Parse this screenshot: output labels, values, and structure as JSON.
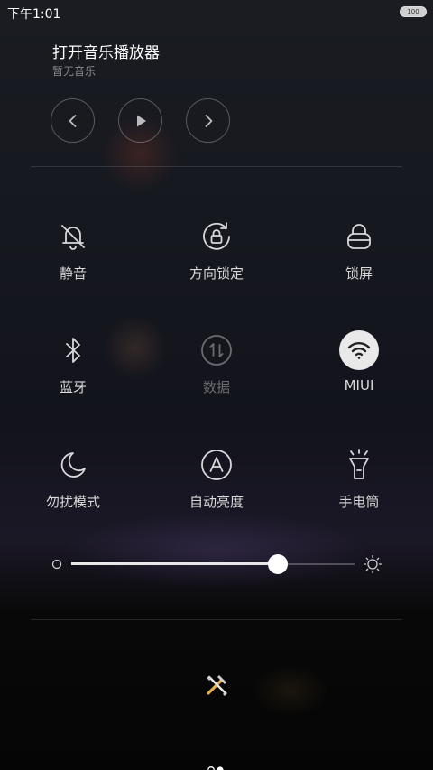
{
  "status_bar": {
    "time": "下午1:01",
    "battery_label": "100"
  },
  "music": {
    "title": "打开音乐播放器",
    "subtitle": "暂无音乐",
    "controls": [
      "previous",
      "play",
      "next"
    ]
  },
  "toggles": [
    {
      "label": "静音",
      "icon": "bell-off-icon",
      "active": false,
      "enabled": true
    },
    {
      "label": "方向锁定",
      "icon": "rotation-lock-icon",
      "active": false,
      "enabled": true
    },
    {
      "label": "锁屏",
      "icon": "lock-icon",
      "active": false,
      "enabled": true
    },
    {
      "label": "蓝牙",
      "icon": "bluetooth-icon",
      "active": false,
      "enabled": true
    },
    {
      "label": "数据",
      "icon": "mobile-data-icon",
      "active": false,
      "enabled": false
    },
    {
      "label": "MIUI",
      "icon": "wifi-icon",
      "active": true,
      "enabled": true
    },
    {
      "label": "勿扰模式",
      "icon": "moon-icon",
      "active": false,
      "enabled": true
    },
    {
      "label": "自动亮度",
      "icon": "auto-brightness-icon",
      "active": false,
      "enabled": true
    },
    {
      "label": "手电筒",
      "icon": "flashlight-icon",
      "active": false,
      "enabled": true
    }
  ],
  "brightness": {
    "level": 0.73
  },
  "colors": {
    "active_tile": "#e9e9ea",
    "label": "#d8d8da",
    "disabled": "#6c6c70"
  }
}
